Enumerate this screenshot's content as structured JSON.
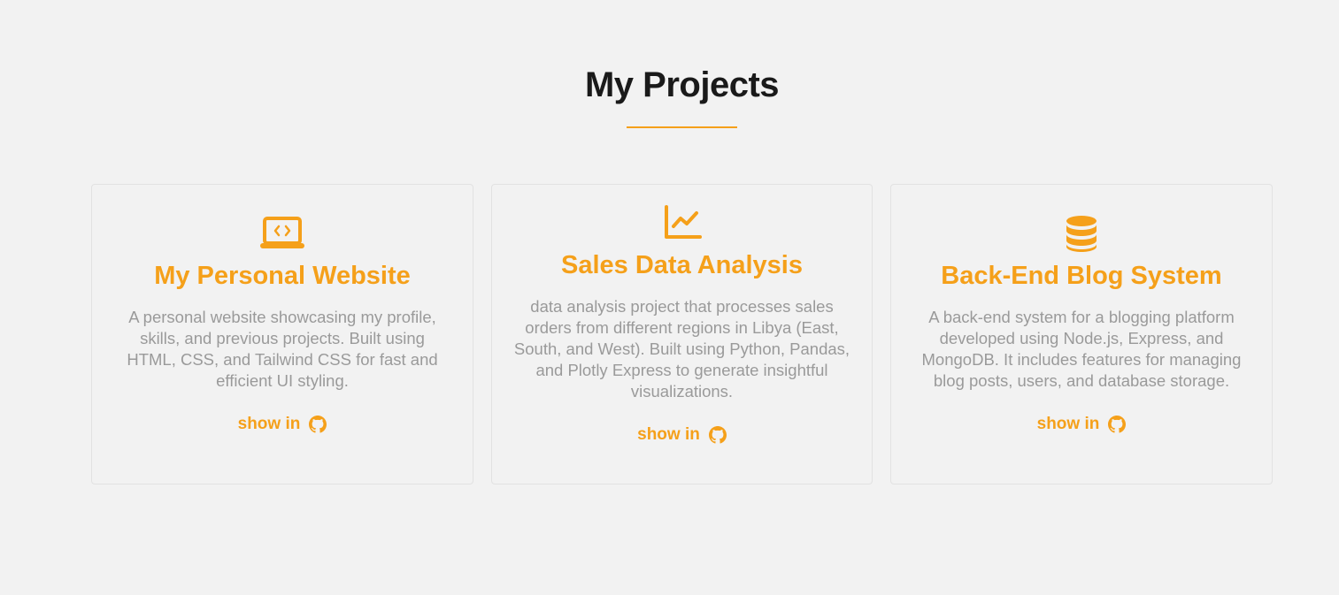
{
  "section": {
    "title": "My Projects"
  },
  "colors": {
    "accent": "#f5a01a",
    "background": "#f2f2f2",
    "heading": "#1a1a1a",
    "body_text": "#9a9a9a"
  },
  "projects": [
    {
      "icon": "laptop-code-icon",
      "title": "My Personal Website",
      "description": "A personal website showcasing my profile, skills, and previous projects. Built using HTML, CSS, and Tailwind CSS for fast and efficient UI styling.",
      "link_label": "show in",
      "link_icon": "github-icon"
    },
    {
      "icon": "chart-line-icon",
      "title": "Sales Data Analysis",
      "description": "data analysis project that processes sales orders from different regions in Libya (East, South, and West). Built using Python, Pandas, and Plotly Express to generate insightful visualizations.",
      "link_label": "show in",
      "link_icon": "github-icon"
    },
    {
      "icon": "database-icon",
      "title": "Back-End Blog System",
      "description": "A back-end system for a blogging platform developed using Node.js, Express, and MongoDB. It includes features for managing blog posts, users, and database storage.",
      "link_label": "show in",
      "link_icon": "github-icon"
    }
  ]
}
